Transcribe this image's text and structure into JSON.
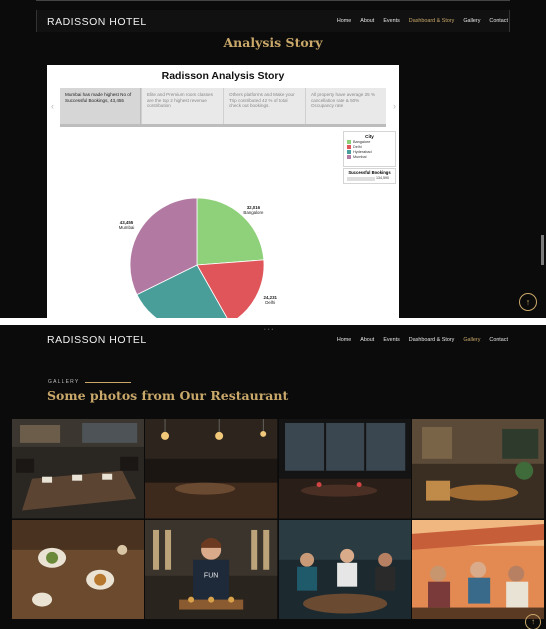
{
  "site": {
    "brand": "RADISSON HOTEL",
    "menu": [
      "Home",
      "About",
      "Events",
      "Dashboard & Story",
      "Gallery",
      "Contact"
    ]
  },
  "screen1": {
    "active_menu": "Dashboard & Story",
    "section_title": "Analysis Story",
    "dashboard": {
      "title": "Radisson Analysis Story",
      "story_points": [
        "Mumbai has made highest No of Successful Bookings, 43,455",
        "Elite and Premium room classes are the top 2 highest revenue contribution",
        "Others platforms and Make your Trip contributed 42 % of total check out bookings.",
        "All property have average 25 % cancellation rate & 50% Occupancy rate"
      ],
      "legend_title": "City",
      "measure_title": "Successful Bookings",
      "measure_value": "134,590",
      "arrow_left": "‹",
      "arrow_right": "›"
    }
  },
  "chart_data": {
    "type": "pie",
    "title": "",
    "categories": [
      "Bangalore",
      "Delhi",
      "Hyderabad",
      "Mumbai"
    ],
    "values": [
      32016,
      24231,
      34888,
      43455
    ],
    "value_labels": [
      "32,016",
      "24,231",
      "",
      "43,455"
    ],
    "colors": [
      "#8fd07a",
      "#e0555a",
      "#4a9e9a",
      "#b27aa2"
    ],
    "legend": "right"
  },
  "screen2": {
    "active_menu": "Gallery",
    "eyebrow": "GALLERY",
    "heading": "Some photos from Our Restaurant",
    "shirt_text": "FUN"
  },
  "icons": {
    "scroll_top": "↑"
  },
  "colors": {
    "gold": "#c9a86a",
    "background": "#0b0b0b"
  }
}
